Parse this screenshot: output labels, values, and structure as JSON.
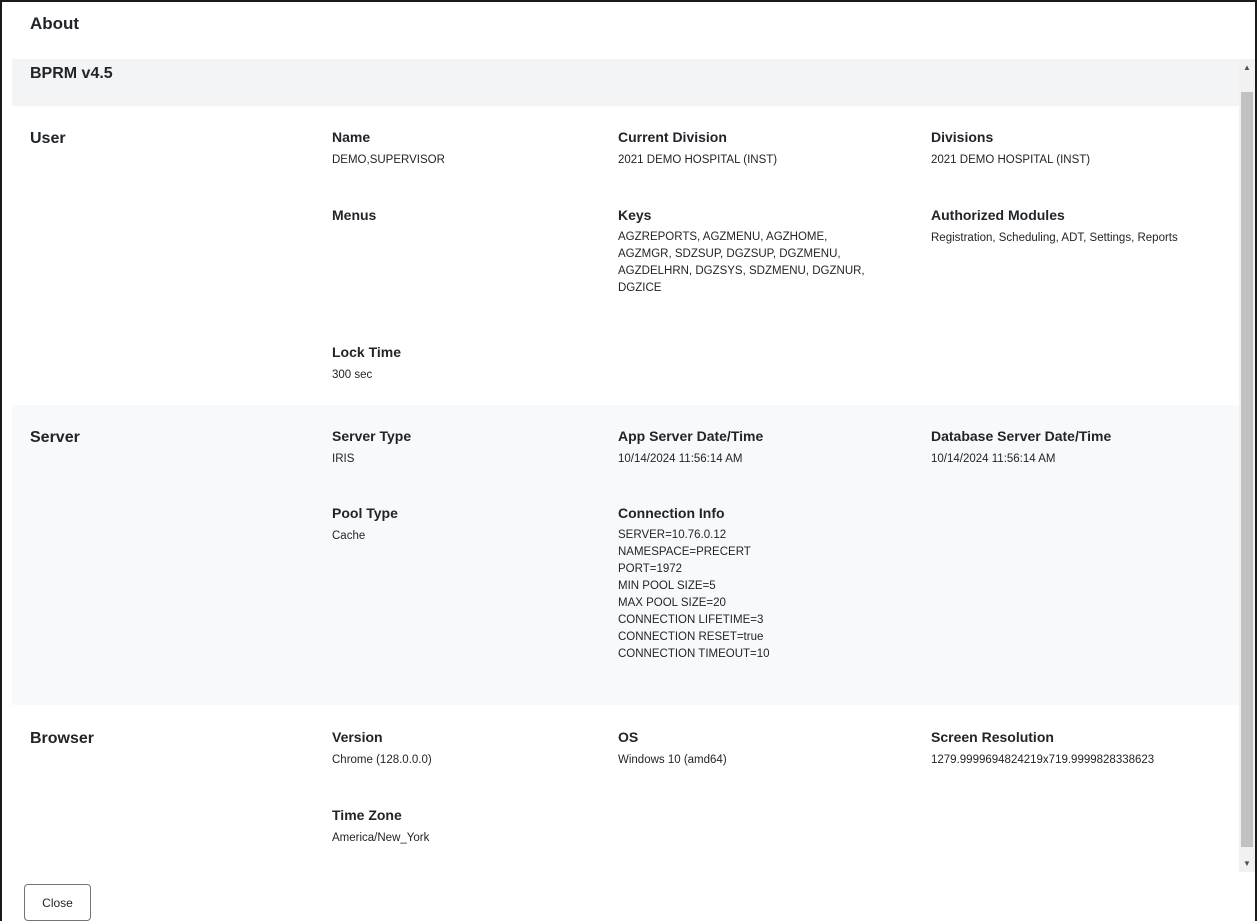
{
  "dialog": {
    "title": "About",
    "close_label": "Close"
  },
  "app": {
    "version": "BPRM v4.5"
  },
  "user": {
    "title": "User",
    "name_label": "Name",
    "name_value": "DEMO,SUPERVISOR",
    "current_division_label": "Current Division",
    "current_division_value": "2021 DEMO HOSPITAL (INST)",
    "divisions_label": "Divisions",
    "divisions_value": "2021 DEMO HOSPITAL (INST)",
    "menus_label": "Menus",
    "menus_value": "",
    "keys_label": "Keys",
    "keys_value": "AGZREPORTS, AGZMENU, AGZHOME,\nAGZMGR, SDZSUP, DGZSUP, DGZMENU,\nAGZDELHRN, DGZSYS, SDZMENU, DGZNUR,\nDGZICE",
    "modules_label": "Authorized Modules",
    "modules_value": "Registration, Scheduling, ADT, Settings, Reports",
    "lock_time_label": "Lock Time",
    "lock_time_value": "300 sec"
  },
  "server": {
    "title": "Server",
    "server_type_label": "Server Type",
    "server_type_value": "IRIS",
    "app_datetime_label": "App Server Date/Time",
    "app_datetime_value": "10/14/2024 11:56:14 AM",
    "db_datetime_label": "Database Server Date/Time",
    "db_datetime_value": "10/14/2024 11:56:14 AM",
    "pool_type_label": "Pool Type",
    "pool_type_value": "Cache",
    "connection_label": "Connection Info",
    "connection_value": "SERVER=10.76.0.12\nNAMESPACE=PRECERT\nPORT=1972\nMIN POOL SIZE=5\nMAX POOL SIZE=20\nCONNECTION LIFETIME=3\nCONNECTION RESET=true\nCONNECTION TIMEOUT=10"
  },
  "browser": {
    "title": "Browser",
    "version_label": "Version",
    "version_value": "Chrome (128.0.0.0)",
    "os_label": "OS",
    "os_value": "Windows 10 (amd64)",
    "resolution_label": "Screen Resolution",
    "resolution_value": "1279.9999694824219x719.9999828338623",
    "timezone_label": "Time Zone",
    "timezone_value": "America/New_York"
  },
  "scrollbar": {
    "up_icon": "triangle-up",
    "down_icon": "triangle-down"
  }
}
